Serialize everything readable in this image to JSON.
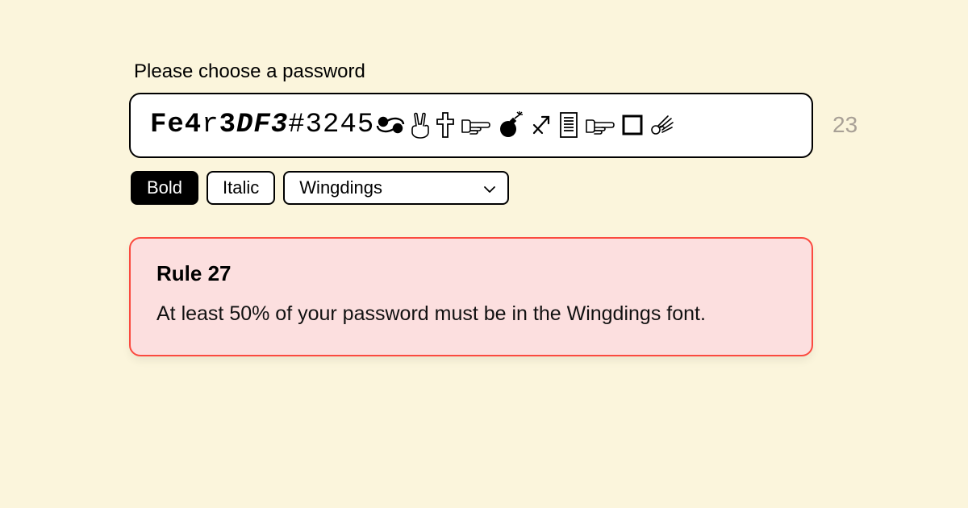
{
  "label": "Please choose a password",
  "password": {
    "segments": {
      "s1": "Fe4",
      "s2": "r",
      "s3": "3",
      "s4": "DF3",
      "s5": "#3245"
    },
    "wingdings_glyphs": [
      "cancer-zodiac",
      "peace-hand",
      "latin-cross",
      "pointing-hand-right",
      "bomb",
      "sagittarius-arrow",
      "document-lines",
      "pointing-hand-right",
      "square",
      "ok-hand"
    ]
  },
  "char_count": "23",
  "toolbar": {
    "bold_label": "Bold",
    "italic_label": "Italic",
    "font_selected": "Wingdings"
  },
  "rule": {
    "title": "Rule 27",
    "text": "At least 50% of your password must be in the Wingdings font."
  },
  "colors": {
    "background": "#fbf5dc",
    "rule_bg": "#fcdfdf",
    "rule_border": "#fb4a3f"
  }
}
